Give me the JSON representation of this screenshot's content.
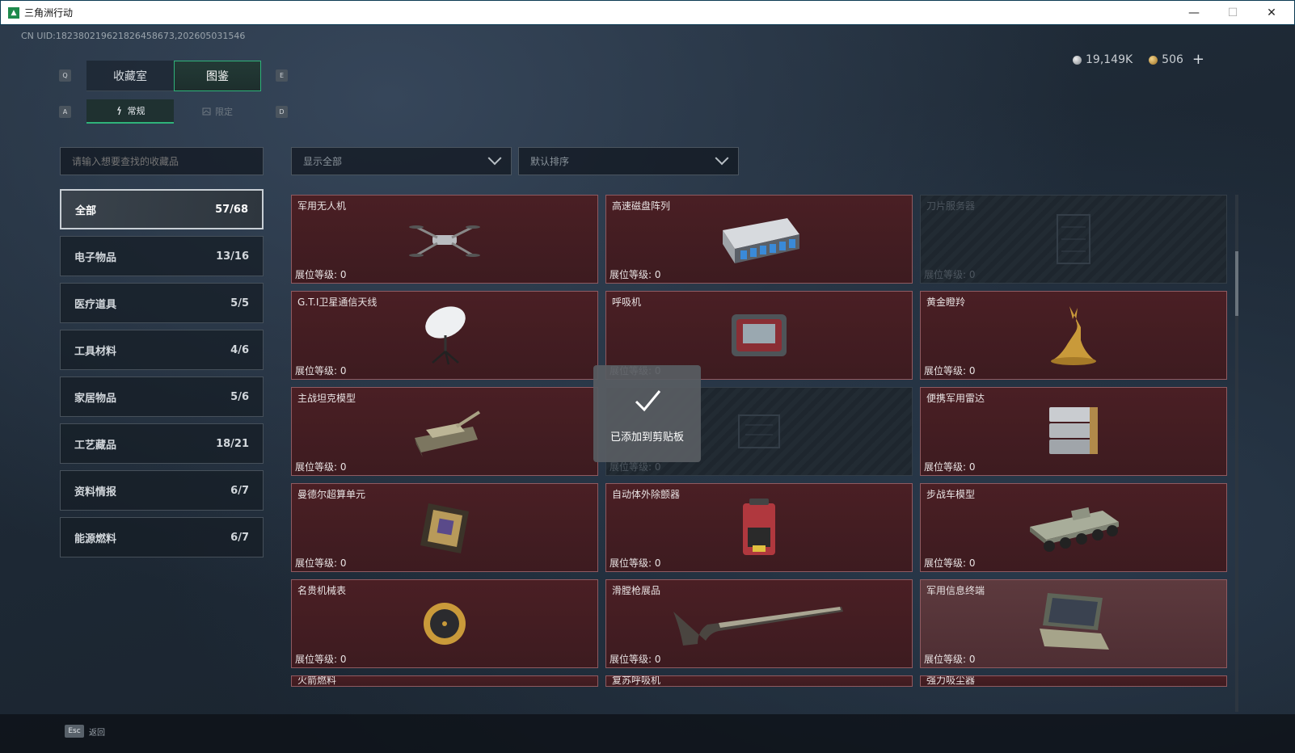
{
  "window": {
    "title": "三角洲行动",
    "minimize": "—",
    "maximize": "☐",
    "close": "✕"
  },
  "uid": "CN UID:1823802196218264586​73,202605031546",
  "currency": {
    "silver": "19,149K",
    "gold": "506",
    "plus": "+"
  },
  "keys": {
    "q": "Q",
    "e": "E",
    "a": "A",
    "d": "D"
  },
  "tabs": {
    "collection_room": "收藏室",
    "catalog": "图鉴"
  },
  "subtabs": {
    "regular": "常规",
    "limited": "限定"
  },
  "search": {
    "placeholder": "请输入想要查找的收藏品"
  },
  "filters": {
    "show": "显示全部",
    "sort": "默认排序"
  },
  "categories": [
    {
      "label": "全部",
      "count": "57/68"
    },
    {
      "label": "电子物品",
      "count": "13/16"
    },
    {
      "label": "医疗道具",
      "count": "5/5"
    },
    {
      "label": "工具材料",
      "count": "4/6"
    },
    {
      "label": "家居物品",
      "count": "5/6"
    },
    {
      "label": "工艺藏品",
      "count": "18/21"
    },
    {
      "label": "资料情报",
      "count": "6/7"
    },
    {
      "label": "能源燃料",
      "count": "6/7"
    }
  ],
  "level_label": "展位等级:  0",
  "items": [
    {
      "name": "军用无人机",
      "icon": "drone-icon"
    },
    {
      "name": "高速磁盘阵列",
      "icon": "disk-array-icon"
    },
    {
      "name": "刀片服务器",
      "icon": "blade-server-icon"
    },
    {
      "name": "G.T.I卫星通信天线",
      "icon": "satellite-antenna-icon"
    },
    {
      "name": "呼吸机",
      "icon": "ventilator-icon"
    },
    {
      "name": "黄金瞪羚",
      "icon": "golden-gazelle-icon"
    },
    {
      "name": "主战坦克模型",
      "icon": "tank-icon"
    },
    {
      "name": "",
      "icon": "locked-item-icon"
    },
    {
      "name": "便携军用雷达",
      "icon": "radar-icon"
    },
    {
      "name": "曼德尔超算单元",
      "icon": "supercomputer-icon"
    },
    {
      "name": "自动体外除颤器",
      "icon": "defibrillator-icon"
    },
    {
      "name": "步战车模型",
      "icon": "ifv-icon"
    },
    {
      "name": "名贵机械表",
      "icon": "watch-icon"
    },
    {
      "name": "滑膛枪展品",
      "icon": "musket-icon"
    },
    {
      "name": "军用信息终端",
      "icon": "terminal-icon"
    },
    {
      "name": "火箭燃料"
    },
    {
      "name": "复苏呼吸机"
    },
    {
      "name": "强力吸尘器"
    }
  ],
  "toast": {
    "text": "已添加到剪贴板"
  },
  "bottom": {
    "esc_key": "Esc",
    "back_label": "返回"
  }
}
